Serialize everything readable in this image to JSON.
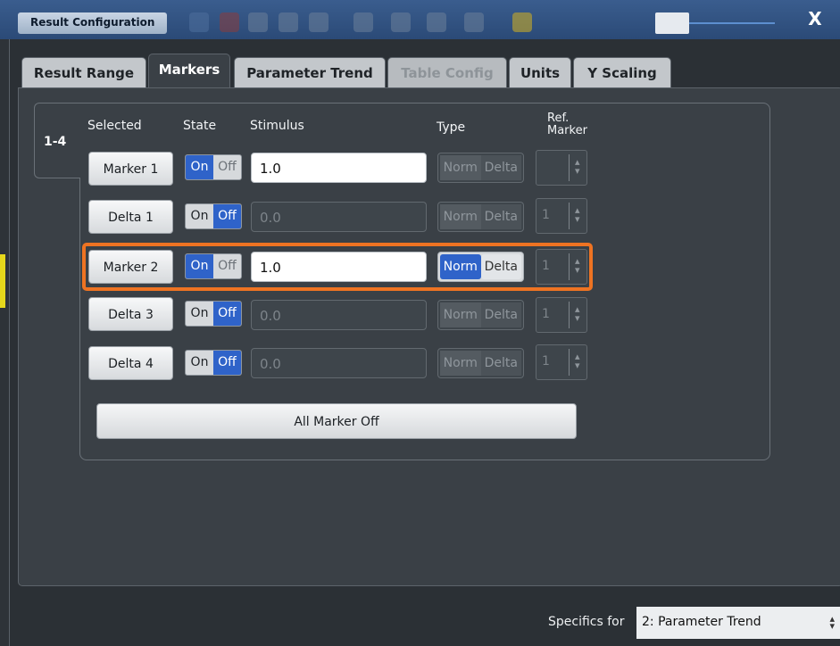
{
  "window": {
    "title": "Result Configuration",
    "close_label": "X"
  },
  "tabs": [
    {
      "label": "Result Range",
      "state": "normal"
    },
    {
      "label": "Markers",
      "state": "active"
    },
    {
      "label": "Parameter Trend",
      "state": "normal"
    },
    {
      "label": "Table Config",
      "state": "disabled"
    },
    {
      "label": "Units",
      "state": "normal"
    },
    {
      "label": "Y Scaling",
      "state": "normal"
    }
  ],
  "subtab": {
    "label": "1-4"
  },
  "headers": {
    "selected": "Selected",
    "state": "State",
    "stimulus": "Stimulus",
    "type": "Type",
    "ref_marker_line1": "Ref.",
    "ref_marker_line2": "Marker"
  },
  "toggle_labels": {
    "on": "On",
    "off": "Off"
  },
  "type_labels": {
    "norm": "Norm",
    "delta": "Delta"
  },
  "markers": [
    {
      "name": "Marker 1",
      "state": "On",
      "stimulus": "1.0",
      "enabled": true,
      "type_enabled": false,
      "ref": ""
    },
    {
      "name": "Delta 1",
      "state": "Off",
      "stimulus": "0.0",
      "enabled": false,
      "type_enabled": false,
      "ref": "1"
    },
    {
      "name": "Marker 2",
      "state": "On",
      "stimulus": "1.0",
      "enabled": true,
      "type_enabled": true,
      "selected_type": "Norm",
      "ref": "1",
      "highlighted": true
    },
    {
      "name": "Delta 3",
      "state": "Off",
      "stimulus": "0.0",
      "enabled": false,
      "type_enabled": false,
      "ref": "1"
    },
    {
      "name": "Delta 4",
      "state": "Off",
      "stimulus": "0.0",
      "enabled": false,
      "type_enabled": false,
      "ref": "1"
    }
  ],
  "all_marker_off": "All Marker Off",
  "footer": {
    "specifics_label": "Specifics for",
    "specifics_value": "2: Parameter Trend"
  },
  "colors": {
    "accent_blue": "#2f63c9",
    "highlight_orange": "#ee7322",
    "titlebar": "#2b4a77"
  }
}
